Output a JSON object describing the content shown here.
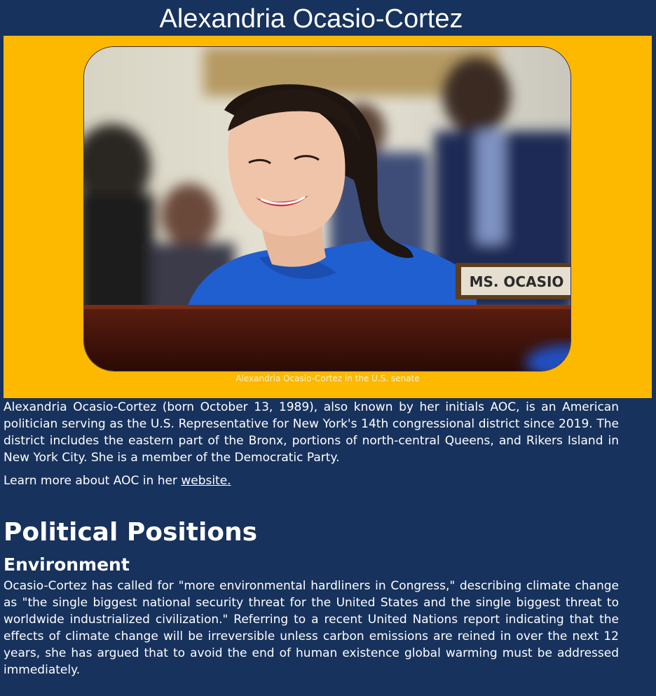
{
  "header": {
    "title": "Alexandria Ocasio-Cortez"
  },
  "figure": {
    "nameplate_text": "MS. OCASIO",
    "caption": "Alexandria Ocasio-Cortez in the U.S. senate"
  },
  "intro": {
    "paragraph": "Alexandria Ocasio-Cortez (born October 13, 1989), also known by her initials AOC, is an American politician serving as the U.S. Representative for New York's 14th congressional district since 2019. The district includes the eastern part of the Bronx, portions of north-central Queens, and Rikers Island in New York City. She is a member of the Democratic Party.",
    "learn_prefix": "Learn more about AOC in her ",
    "learn_link": "website."
  },
  "positions": {
    "heading": "Political Positions",
    "environment": {
      "heading": "Environment",
      "paragraph": "Ocasio-Cortez has called for \"more environmental hardliners in Congress,\" describing climate change as \"the single biggest national security threat for the United States and the single biggest threat to worldwide industrialized civilization.\" Referring to a recent United Nations report indicating that the effects of climate change will be irreversible unless carbon emissions are reined in over the next 12 years, she has argued that to avoid the end of human existence global warming must be addressed immediately."
    }
  },
  "colors": {
    "page_background": "#17325c",
    "figure_background": "#fdb800",
    "text": "#ffffff",
    "dress": "#1f5fd0"
  }
}
